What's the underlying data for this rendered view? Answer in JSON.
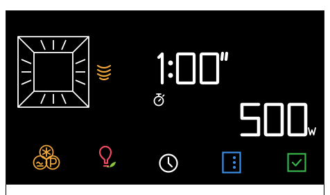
{
  "display": {
    "time": {
      "minutes": "1",
      "seconds": "00",
      "seconds_mark": "\""
    },
    "power": {
      "value": "500",
      "unit": "w"
    }
  },
  "icons": {
    "microwave_program": "microwave-program-icon",
    "waves": "microwave-waves-icon",
    "timer": "stopwatch-icon",
    "defrost_program": "defrost-program-icon",
    "eco_light": "eco-light-icon",
    "clock": "clock-icon",
    "menu": "menu-icon",
    "confirm": "confirm-icon"
  },
  "colors": {
    "background": "#000000",
    "segment": "#ffffff",
    "accent_orange": "#f2a83a",
    "accent_pink": "#ee4b63",
    "accent_green": "#8cc63f",
    "accent_blue": "#3c8fe8",
    "accent_confirm": "#39b54a"
  }
}
